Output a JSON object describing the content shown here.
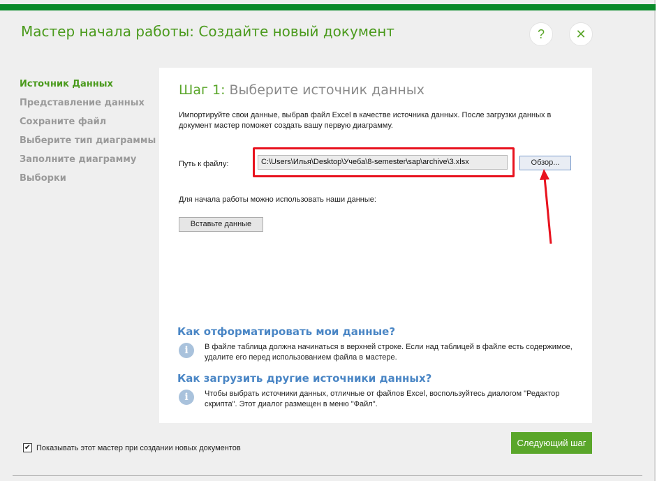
{
  "window": {
    "title": "Мастер начала работы: Создайте новый документ",
    "help_label": "?",
    "close_label": "✕"
  },
  "nav": {
    "items": [
      {
        "label": "Источник Данных",
        "active": true
      },
      {
        "label": "Представление данных"
      },
      {
        "label": "Сохраните файл"
      },
      {
        "label": "Выберите тип диаграммы"
      },
      {
        "label": "Заполните диаграмму"
      },
      {
        "label": "Выборки"
      }
    ]
  },
  "step": {
    "number": "Шаг 1:",
    "title": "Выберите источник данных",
    "intro": "Импортируйте свои данные, выбрав файл Excel в качестве источника данных. После загрузки данных в документ мастер поможет создать вашу первую диаграмму.",
    "path_label": "Путь к файлу:",
    "path_value": "C:\\Users\\Илья\\Desktop\\Учеба\\8-semester\\sap\\archive\\3.xlsx",
    "browse_label": "Обзор...",
    "sample_text": "Для начала работы можно использовать наши данные:",
    "paste_label": "Вставьте данные"
  },
  "help_sections": [
    {
      "title": "Как отформатировать мои данные?",
      "icon": "info-icon",
      "text": "В файле таблица должна начинаться в верхней строке. Если над таблицей в файле есть содержимое, удалите его перед использованием файла в мастере."
    },
    {
      "title": "Как загрузить другие источники данных?",
      "icon": "info-icon",
      "text": "Чтобы выбрать источники данных, отличные от файлов Excel, воспользуйтесь диалогом \"Редактор скрипта\". Этот диалог размещен в меню \"Файл\"."
    }
  ],
  "footer": {
    "checkbox_label": "Показывать этот мастер при создании новых документов",
    "checkbox_checked": true,
    "next_label": "Следующий шаг"
  },
  "colors": {
    "accent_green": "#5aa62a",
    "title_green": "#4a9a1c",
    "header_bar": "#0a8a2a",
    "link_blue": "#4a86c5",
    "highlight_red": "#e8121e"
  }
}
